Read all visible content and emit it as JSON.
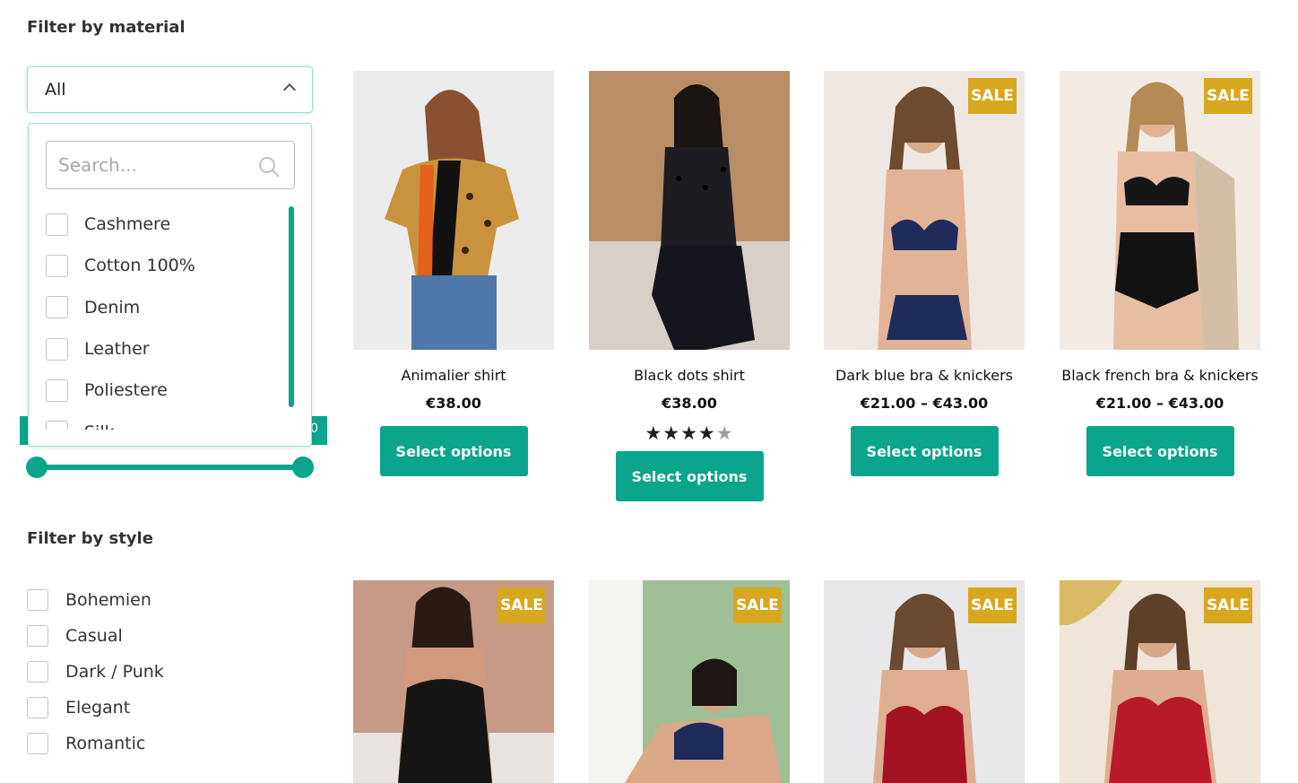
{
  "material_filter": {
    "title": "Filter by material",
    "selected": "All",
    "search_placeholder": "Search...",
    "options": [
      "Cashmere",
      "Cotton 100%",
      "Denim",
      "Leather",
      "Poliestere",
      "Silk"
    ]
  },
  "price_filter": {
    "max_label": "0"
  },
  "style_filter": {
    "title": "Filter by style",
    "options": [
      "Bohemien",
      "Casual",
      "Dark / Punk",
      "Elegant",
      "Romantic"
    ]
  },
  "products": [
    {
      "name": "Animalier shirt",
      "price": "€38.00",
      "sale": false,
      "button": "Select options"
    },
    {
      "name": "Black dots shirt",
      "price": "€38.00",
      "sale": false,
      "rating_stars": 4,
      "rating_display": "★★★★",
      "rating_empty": "★",
      "button": "Select options"
    },
    {
      "name": "Dark blue bra & knickers",
      "price": "€21.00 – €43.00",
      "sale": true,
      "badge": "SALE",
      "button": "Select options"
    },
    {
      "name": "Black french bra & knickers",
      "price": "€21.00 – €43.00",
      "sale": true,
      "badge": "SALE",
      "button": "Select options"
    },
    {
      "sale": true,
      "badge": "SALE"
    },
    {
      "sale": true,
      "badge": "SALE"
    },
    {
      "sale": true,
      "badge": "SALE"
    },
    {
      "sale": true,
      "badge": "SALE"
    }
  ],
  "colors": {
    "accent": "#0aa58b",
    "sale_badge": "#d7a81f"
  }
}
